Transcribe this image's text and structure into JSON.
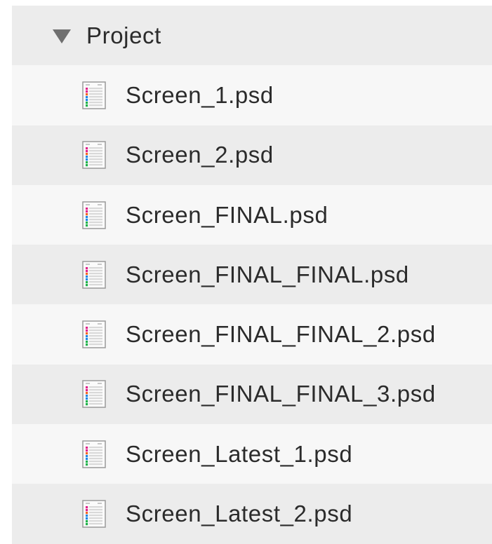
{
  "project": {
    "label": "Project",
    "expanded": true,
    "toggle_icon": "triangle-down-icon"
  },
  "files": [
    {
      "name": "Screen_1.psd",
      "icon": "psd-file-icon"
    },
    {
      "name": "Screen_2.psd",
      "icon": "psd-file-icon"
    },
    {
      "name": "Screen_FINAL.psd",
      "icon": "psd-file-icon"
    },
    {
      "name": "Screen_FINAL_FINAL.psd",
      "icon": "psd-file-icon"
    },
    {
      "name": "Screen_FINAL_FINAL_2.psd",
      "icon": "psd-file-icon"
    },
    {
      "name": "Screen_FINAL_FINAL_3.psd",
      "icon": "psd-file-icon"
    },
    {
      "name": "Screen_Latest_1.psd",
      "icon": "psd-file-icon"
    },
    {
      "name": "Screen_Latest_2.psd",
      "icon": "psd-file-icon"
    }
  ],
  "colors": {
    "row_shaded": "#ececec",
    "row_plain": "#f7f7f7",
    "text": "#2b2b2b",
    "triangle": "#6f6f6f",
    "icon_stripes": [
      "#e0218a",
      "#f26522",
      "#1e88e5",
      "#20b24a"
    ]
  }
}
